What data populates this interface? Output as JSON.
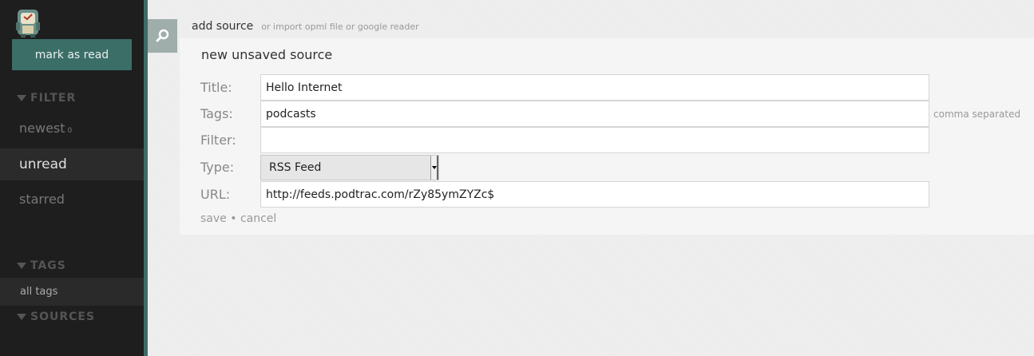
{
  "sidebar": {
    "mark_as_read": "mark as read",
    "filter_heading": "FILTER",
    "filters": [
      {
        "label": "newest",
        "count": "0"
      },
      {
        "label": "unread"
      },
      {
        "label": "starred"
      }
    ],
    "tags_heading": "TAGS",
    "tags": [
      {
        "label": "all tags"
      }
    ],
    "sources_heading": "SOURCES"
  },
  "header": {
    "add_source": "add source",
    "import": "or import opml file or google reader"
  },
  "form": {
    "title": "new unsaved source",
    "labels": {
      "title": "Title:",
      "tags": "Tags:",
      "filter": "Filter:",
      "type": "Type:",
      "url": "URL:"
    },
    "values": {
      "title": "Hello Internet",
      "tags": "podcasts",
      "filter": "",
      "type": "RSS Feed",
      "url": "http://feeds.podtrac.com/rZy85ymZYZc$"
    },
    "tags_hint": "comma separated",
    "save": "save",
    "separator": "•",
    "cancel": "cancel"
  },
  "colors": {
    "sidebar_bg": "#1e1e1e",
    "accent": "#3c6e68",
    "search_button": "#9fadab"
  }
}
